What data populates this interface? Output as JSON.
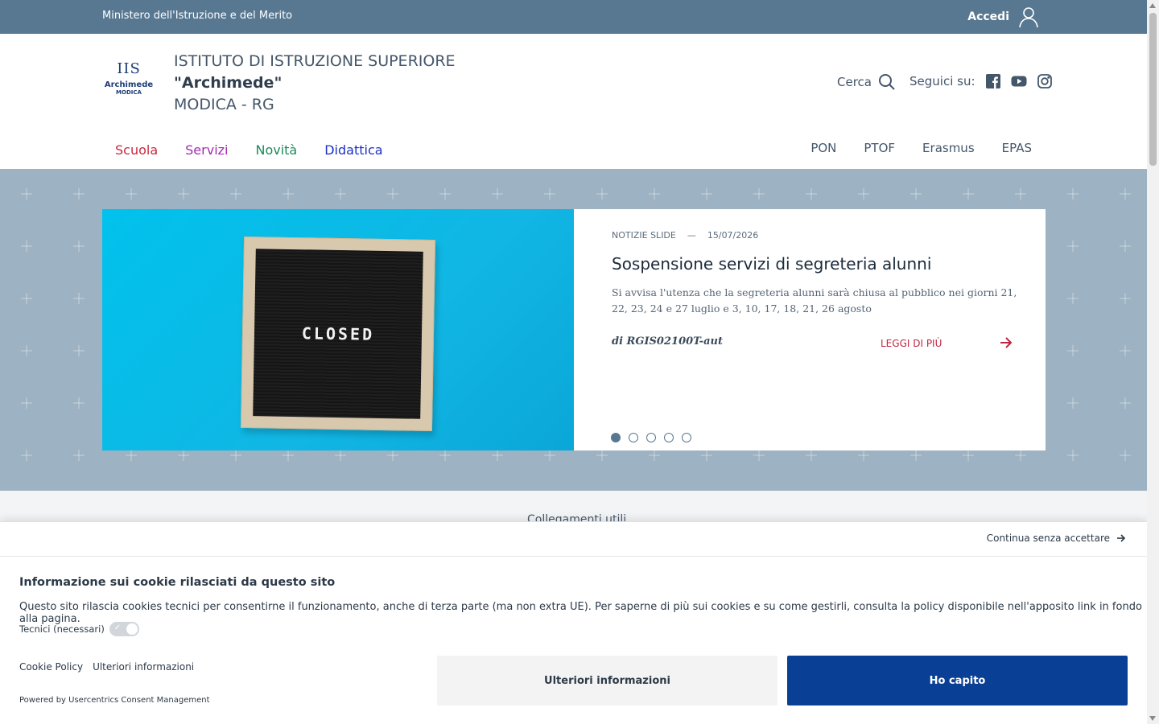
{
  "topbar": {
    "ministry": "Ministero dell'Istruzione e del Merito",
    "login": "Accedi"
  },
  "header": {
    "logo": {
      "mark": "IIS",
      "name": "Archimede",
      "city": "MODICA"
    },
    "school": {
      "line1": "ISTITUTO DI ISTRUZIONE SUPERIORE",
      "line2": "\"Archimede\"",
      "line3": "MODICA - RG"
    },
    "search_label": "Cerca",
    "social_label": "Seguici su:",
    "social_icons": [
      "facebook-icon",
      "youtube-icon",
      "instagram-icon"
    ]
  },
  "main_nav": [
    {
      "label": "Scuola",
      "color": "#c8283f"
    },
    {
      "label": "Servizi",
      "color": "#a32ab0"
    },
    {
      "label": "Novità",
      "color": "#1a8a5a"
    },
    {
      "label": "Didattica",
      "color": "#1d2fc8"
    }
  ],
  "sub_nav": [
    "PON",
    "PTOF",
    "Erasmus",
    "EPAS"
  ],
  "slide": {
    "image_text": "CLOSED",
    "category": "Notizie slide",
    "separator": "—",
    "date": "15/07/2026",
    "title": "Sospensione servizi di segreteria alunni",
    "text": "Si avvisa l'utenza che la segreteria alunni sarà chiusa al pubblico nei giorni 21, 22, 23, 24 e 27 luglio e 3, 10, 17, 18, 21, 26 agosto",
    "author": "di RGIS02100T-aut",
    "read_more": "LEGGI DI PIÙ",
    "dots_total": 5,
    "dot_active": 1
  },
  "useful_links_title": "Collegamenti utili",
  "cookie": {
    "skip": "Continua senza accettare",
    "title": "Informazione sui cookie rilasciati da questo sito",
    "description": "Questo sito rilascia cookies tecnici per consentirne il funzionamento, anche di terza parte (ma non extra UE). Per saperne di più sui cookies e su come gestirli, consulta la policy disponibile nell'apposito link in fondo alla pagina.",
    "toggle_label": "Tecnici (necessari)",
    "link_policy": "Cookie Policy",
    "link_more": "Ulteriori informazioni",
    "powered": "Powered by Usercentrics Consent Management",
    "btn_more": "Ulteriori informazioni",
    "btn_ok": "Ho capito"
  },
  "colors": {
    "topbar": "#587891",
    "hero": "#6e8ca3",
    "accent_red": "#c0253f",
    "primary_blue": "#0a3f96"
  }
}
